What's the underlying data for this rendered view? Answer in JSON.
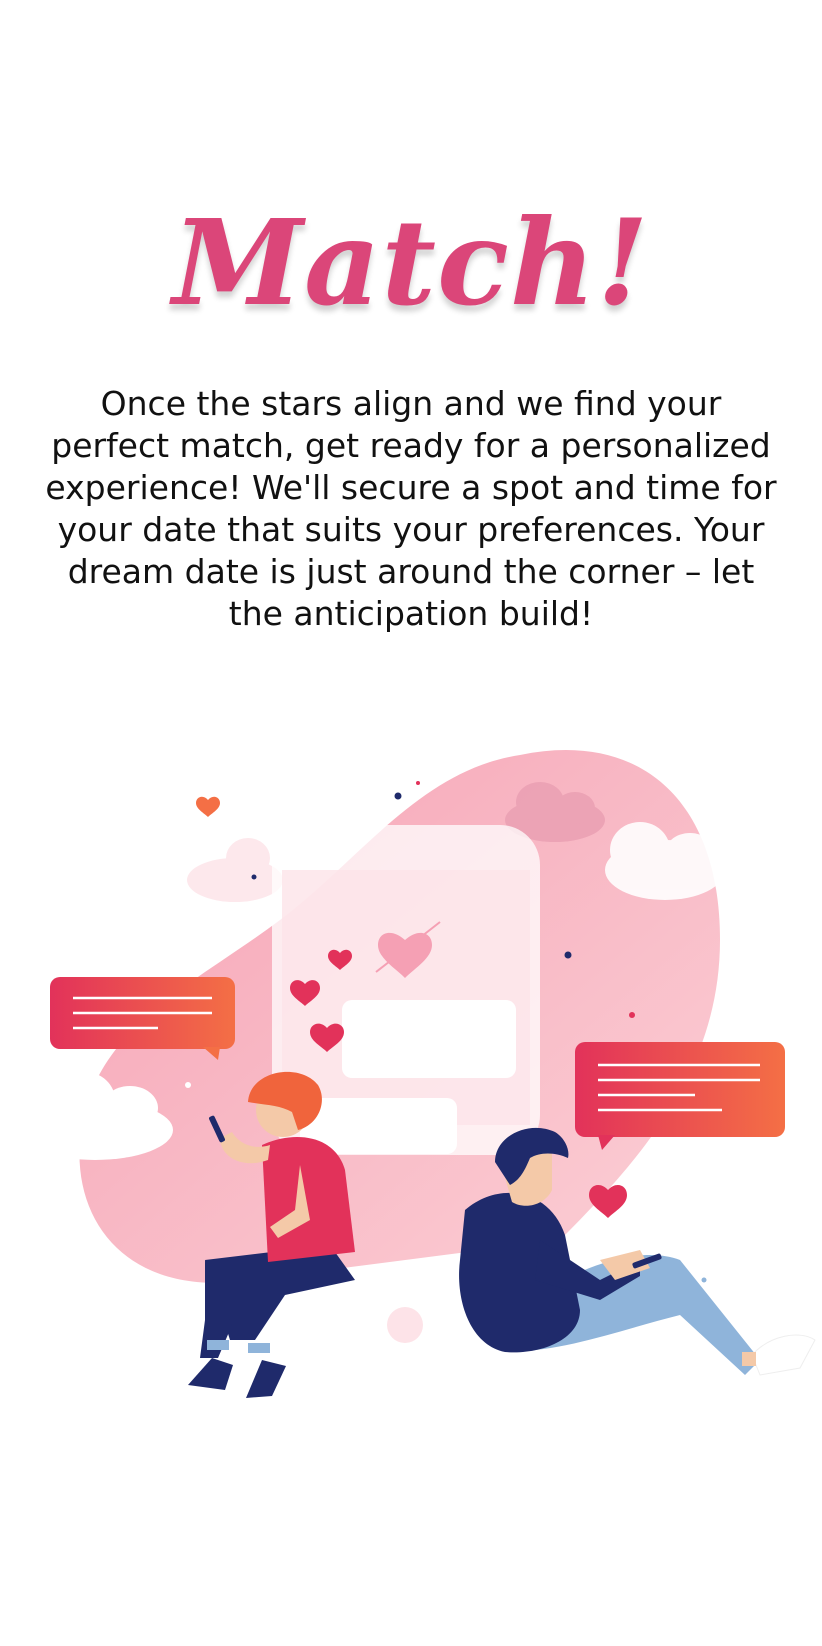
{
  "screen": {
    "title": "Match!",
    "description": "Once the stars align and we find your perfect match, get ready for a personalized experience! We'll secure a spot and time for your date that suits your preferences. Your dream date is just around the corner – let the anticipation build!"
  },
  "illustration": {
    "subject": "couple-chatting-on-phones",
    "colors": {
      "blob": "#f7b6c2",
      "accent": "#e2325a",
      "gradient_end": "#f46f45",
      "navy": "#1f2a6b",
      "denim": "#8fb4da",
      "skin": "#f4c9a8",
      "hair_woman": "#f0643c"
    }
  },
  "colors": {
    "title": "#db4679",
    "text": "#111111",
    "background": "#ffffff"
  }
}
